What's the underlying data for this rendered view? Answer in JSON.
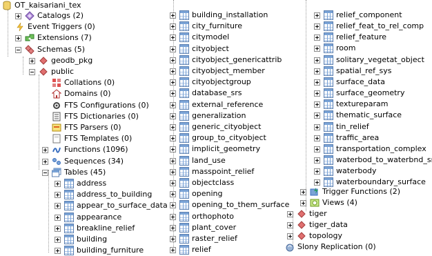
{
  "root": {
    "label": "OT_kaisariani_tex"
  },
  "col1_top": [
    {
      "label": "Catalogs (2)",
      "icon": "catalogs-icon",
      "exp": "plus"
    },
    {
      "label": "Event Triggers (0)",
      "icon": "event-triggers-icon",
      "exp": "none"
    },
    {
      "label": "Extensions (7)",
      "icon": "extensions-icon",
      "exp": "plus"
    },
    {
      "label": "Schemas (5)",
      "icon": "schemas-icon",
      "exp": "minus"
    }
  ],
  "schemas_children": [
    {
      "label": "geodb_pkg",
      "icon": "schema-icon",
      "exp": "plus"
    },
    {
      "label": "public",
      "icon": "schema-icon",
      "exp": "minus"
    }
  ],
  "public_children": [
    {
      "label": "Collations (0)",
      "icon": "collations-icon"
    },
    {
      "label": "Domains (0)",
      "icon": "domains-icon"
    },
    {
      "label": "FTS Configurations (0)",
      "icon": "fts-configurations-icon"
    },
    {
      "label": "FTS Dictionaries (0)",
      "icon": "fts-dictionaries-icon"
    },
    {
      "label": "FTS Parsers (0)",
      "icon": "fts-parsers-icon"
    },
    {
      "label": "FTS Templates (0)",
      "icon": "fts-templates-icon"
    },
    {
      "label": "Functions (1096)",
      "icon": "functions-icon",
      "exp": "plus"
    },
    {
      "label": "Sequences (34)",
      "icon": "sequences-icon",
      "exp": "plus"
    },
    {
      "label": "Tables (45)",
      "icon": "tables-icon",
      "exp": "minus"
    }
  ],
  "tables_col1": [
    "address",
    "address_to_building",
    "appear_to_surface_data",
    "appearance",
    "breakline_relief",
    "building",
    "building_furniture"
  ],
  "tables_col2": [
    "building_installation",
    "city_furniture",
    "citymodel",
    "cityobject",
    "cityobject_genericattrib",
    "cityobject_member",
    "cityobjectgroup",
    "database_srs",
    "external_reference",
    "generalization",
    "generic_cityobject",
    "group_to_cityobject",
    "implicit_geometry",
    "land_use",
    "masspoint_relief",
    "objectclass",
    "opening",
    "opening_to_them_surface",
    "orthophoto",
    "plant_cover",
    "raster_relief",
    "relief"
  ],
  "tables_col3": [
    "relief_component",
    "relief_feat_to_rel_comp",
    "relief_feature",
    "room",
    "solitary_vegetat_object",
    "spatial_ref_sys",
    "surface_data",
    "surface_geometry",
    "textureparam",
    "thematic_surface",
    "tin_relief",
    "traffic_area",
    "transportation_complex",
    "waterbod_to_waterbnd_srf",
    "waterbody",
    "waterboundary_surface"
  ],
  "after_tables": [
    {
      "label": "Trigger Functions (2)",
      "icon": "trigger-functions-icon"
    },
    {
      "label": "Views (4)",
      "icon": "views-icon"
    }
  ],
  "other_schemas": [
    {
      "label": "tiger",
      "icon": "schema-icon"
    },
    {
      "label": "tiger_data",
      "icon": "schema-icon"
    },
    {
      "label": "topology",
      "icon": "schema-icon"
    }
  ],
  "slony": {
    "label": "Slony Replication (0)",
    "icon": "slony-replication-icon"
  }
}
